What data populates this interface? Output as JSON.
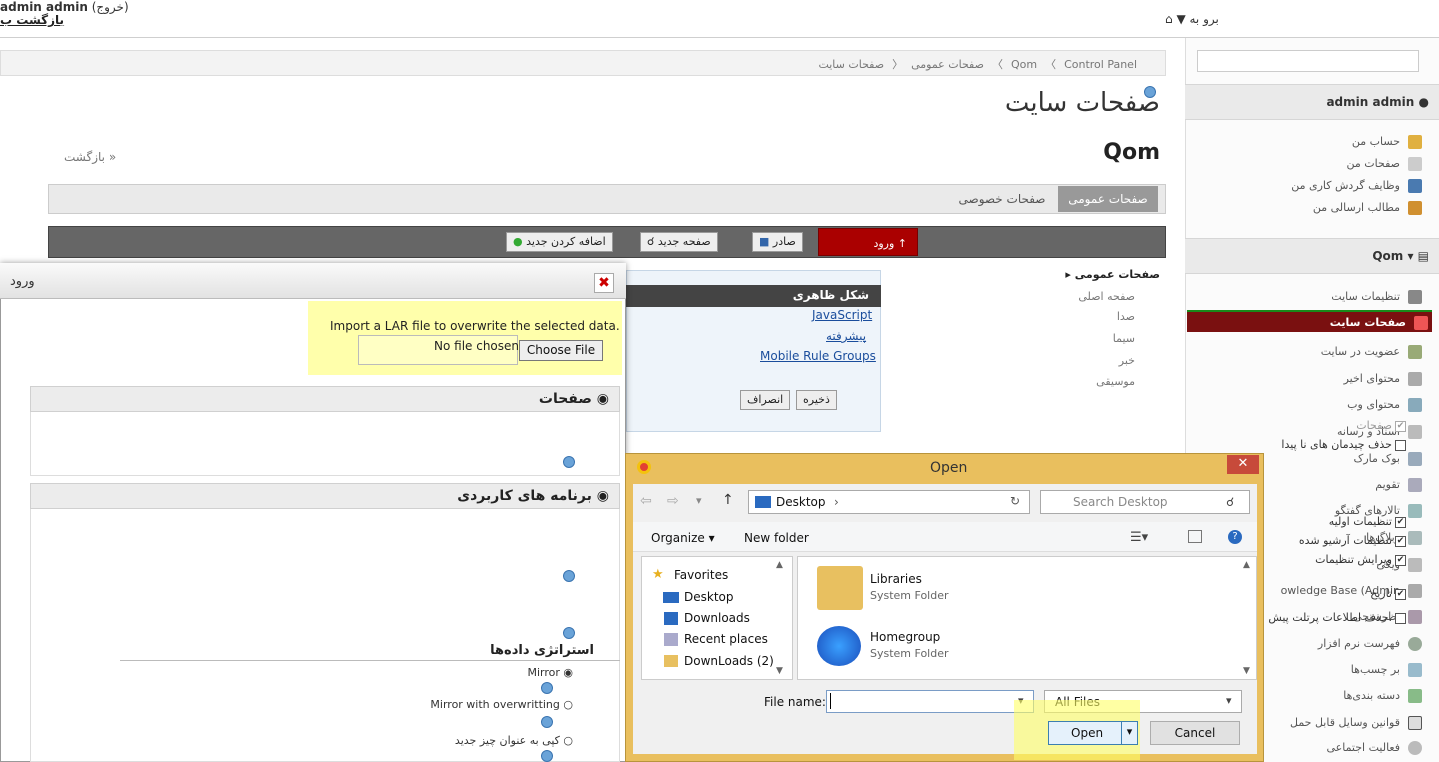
{
  "topbar": {
    "back_site": "بازگشت ب",
    "go_to": "▼ برو به",
    "user": "admin admin",
    "signout": "(خروج)"
  },
  "dock": {
    "user_name": "admin admin",
    "items": [
      "حساب من",
      "صفحات من",
      "وظایف گردش کاری من",
      "مطالب ارسالی من"
    ],
    "site_name": "Qom",
    "site_items": [
      "تنظیمات سایت",
      "صفحات سایت",
      "عضویت در سایت",
      "محتوای اخیر",
      "محتوای وب",
      "اسناد و رسانه",
      "بوک مارک",
      "تقویم",
      "تالارهای گفتگو",
      "وبلاگ‌ها",
      "ویکی",
      "owledge Base (Admin",
      "نظرسنجی",
      "فهرست نرم افزار",
      "بر چسب‌ها",
      "دسته بندی‌ها",
      "قوانین وسایل قابل حمل",
      "فعالیت اجتماعی"
    ]
  },
  "breadcrumb": [
    "Control Panel",
    "Qom",
    "صفحات سایت",
    "صفحات عمومی"
  ],
  "page": {
    "title": "صفحات سایت",
    "site": "Qom",
    "back": "بازگشت »"
  },
  "tabs": {
    "public": "صفحات عمومی",
    "private": "صفحات خصوصی"
  },
  "toolbar": {
    "add": "اضافه کردن جدید",
    "new_page": "صفحه جدید",
    "export": "صادر",
    "import": "ورود"
  },
  "tree": {
    "root": "صفحات عمومی",
    "items": [
      "صفحه اصلی",
      "صدا",
      "سیما",
      "خبر",
      "موسیقی"
    ]
  },
  "settings": {
    "head": "شکل ظاهری",
    "links": [
      "JavaScript",
      "پیشرفته",
      "Mobile Rule Groups"
    ],
    "save": "ذخیره",
    "cancel": "انصراف"
  },
  "import_dialog": {
    "title": "ورود",
    "intro": "Import a LAR file to overwrite the selected data.",
    "no_file": "No file chosen",
    "choose": "Choose File",
    "pages_head": "صفحات",
    "pages_cb": "صفحات",
    "delete_missing": "حذف چیدمان های نا پیدا",
    "apps_head": "برنامه های کاربردی",
    "apps": [
      "تنظیمات اولیه",
      "تنظیمات آرشیو شده",
      "ویرایش تنظیمات",
      "تاریخ"
    ],
    "delete_portlet": "حذف اطلاعات پرتلت پیش از ورود.",
    "strategy": "استراتژی داده‌ها",
    "mirror": "Mirror",
    "mirror_over": "Mirror with overwritting",
    "copy_new": "کپی به عنوان چیز جدید"
  },
  "open_dialog": {
    "title": "Open",
    "path": "Desktop",
    "search": "Search Desktop",
    "organize": "Organize ▾",
    "new_folder": "New folder",
    "nav": [
      "Favorites",
      "Desktop",
      "Downloads",
      "Recent places",
      "DownLoads (2)"
    ],
    "files": [
      {
        "name": "Libraries",
        "type": "System Folder"
      },
      {
        "name": "Homegroup",
        "type": "System Folder"
      }
    ],
    "file_name_label": "File name:",
    "filter": "All Files",
    "open": "Open",
    "cancel": "Cancel"
  }
}
